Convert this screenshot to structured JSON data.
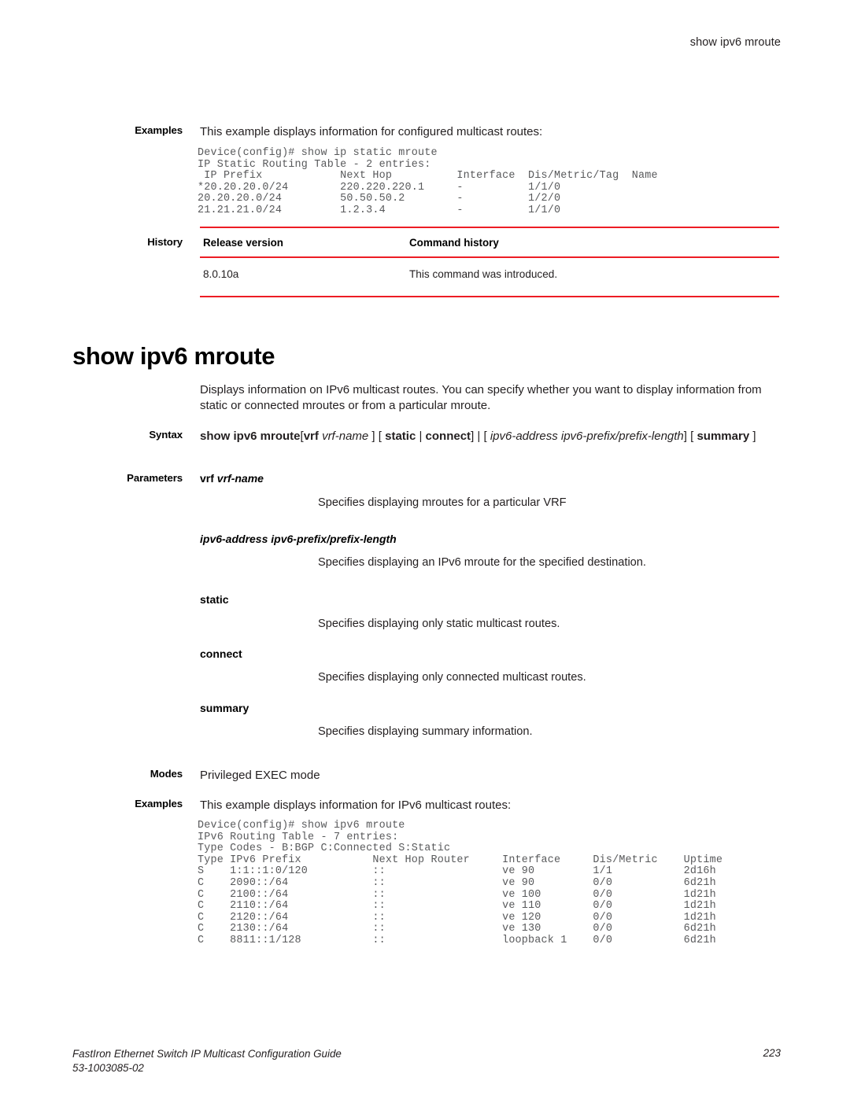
{
  "header": {
    "running_head": "show ipv6 mroute"
  },
  "top_example": {
    "label": "Examples",
    "intro": "This example displays information for configured multicast routes:",
    "console": "Device(config)# show ip static mroute\nIP Static Routing Table - 2 entries:\n IP Prefix            Next Hop          Interface  Dis/Metric/Tag  Name\n*20.20.20.0/24        220.220.220.1     -          1/1/0\n20.20.20.0/24         50.50.50.2        -          1/2/0\n21.21.21.0/24         1.2.3.4           -          1/1/0"
  },
  "history": {
    "label": "History",
    "columns": [
      "Release version",
      "Command history"
    ],
    "rows": [
      {
        "release": "8.0.10a",
        "history": "This command was introduced."
      }
    ],
    "rule_color": "#ed1c24"
  },
  "command": {
    "title": "show ipv6 mroute",
    "description": "Displays information on IPv6 multicast routes. You can specify whether you want to display information from static or connected mroutes or from a particular mroute."
  },
  "syntax": {
    "label": "Syntax",
    "parts": {
      "command": "show ipv6 mroute",
      "open1": "[",
      "vrf_keyword": "vrf",
      "vrf_value": "vrf-name",
      "close1": "]",
      "open2": "[",
      "static": "static",
      "pipe1": "|",
      "connect": "connect",
      "close2": "]",
      "pipe2": "|",
      "open3": "[",
      "ipv6_address": "ipv6-address ipv6-prefix/prefix-length",
      "close3": "]",
      "open4": "[",
      "summary": "summary",
      "close4": "]"
    },
    "full_text": "show ipv6 mroute [vrf vrf-name ] [ static | connect] | [ ipv6-address ipv6-prefix/prefix-length] [ summary ]"
  },
  "parameters": {
    "label": "Parameters",
    "items": [
      {
        "term_bold": "vrf",
        "term_italic": "vrf-name",
        "description": "Specifies displaying mroutes for a particular VRF"
      },
      {
        "term_bold": "",
        "term_italic": "ipv6-address ipv6-prefix/prefix-length",
        "description": "Specifies displaying an IPv6 mroute for the specified destination."
      },
      {
        "term_bold": "static",
        "term_italic": "",
        "description": "Specifies displaying only static multicast routes."
      },
      {
        "term_bold": "connect",
        "term_italic": "",
        "description": "Specifies displaying only connected multicast routes."
      },
      {
        "term_bold": "summary",
        "term_italic": "",
        "description": "Specifies displaying summary information."
      }
    ]
  },
  "modes": {
    "label": "Modes",
    "value": "Privileged EXEC mode"
  },
  "bottom_example": {
    "label": "Examples",
    "intro": "This example displays information for IPv6 multicast routes:",
    "console": "Device(config)# show ipv6 mroute\nIPv6 Routing Table - 7 entries:\nType Codes - B:BGP C:Connected S:Static\nType IPv6 Prefix           Next Hop Router     Interface     Dis/Metric    Uptime\nS    1:1::1:0/120          ::                  ve 90         1/1           2d16h\nC    2090::/64             ::                  ve 90         0/0           6d21h\nC    2100::/64             ::                  ve 100        0/0           1d21h\nC    2110::/64             ::                  ve 110        0/0           1d21h\nC    2120::/64             ::                  ve 120        0/0           1d21h\nC    2130::/64             ::                  ve 130        0/0           6d21h\nC    8811::1/128           ::                  loopback 1    0/0           6d21h"
  },
  "footer": {
    "guide_title": "FastIron Ethernet Switch IP Multicast Configuration Guide",
    "doc_number": "53-1003085-02",
    "page_number": "223"
  }
}
